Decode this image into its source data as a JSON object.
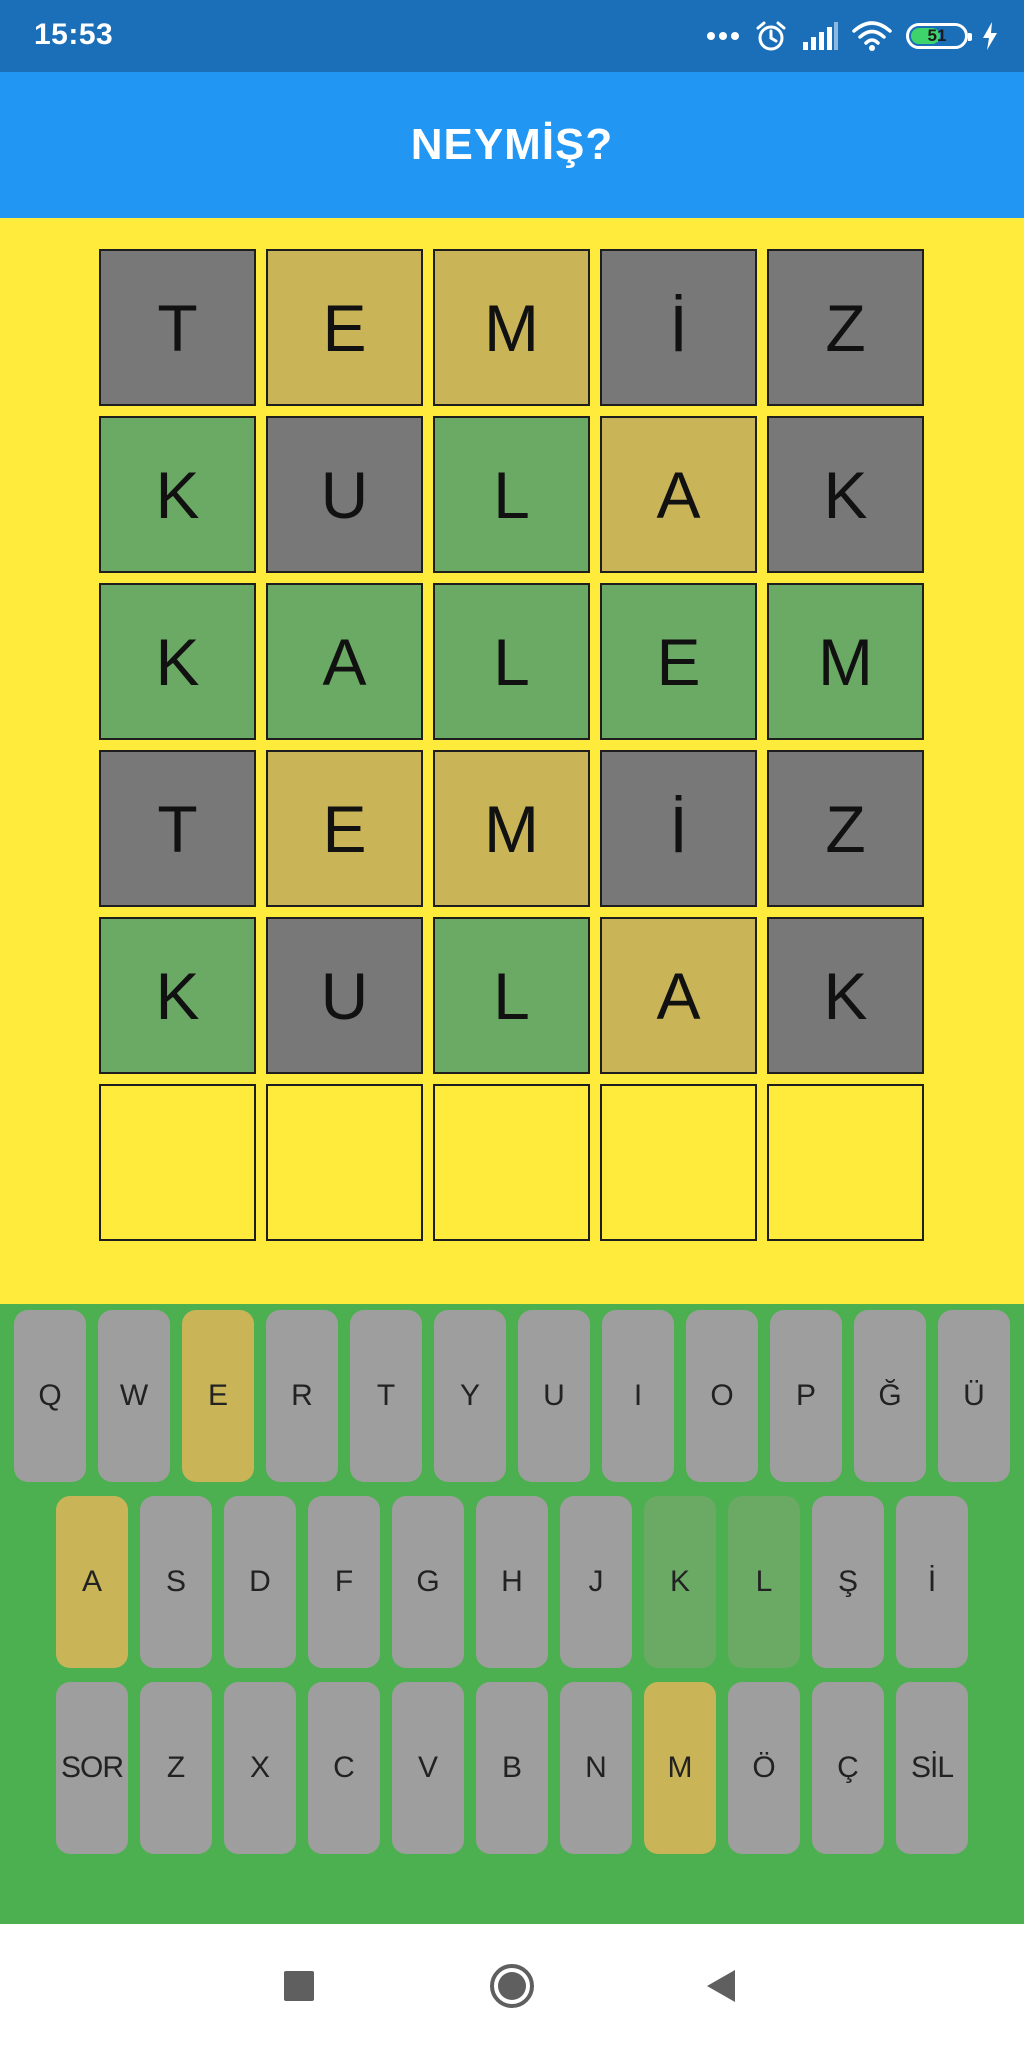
{
  "status_bar": {
    "time": "15:53",
    "battery_level": "51",
    "icons": [
      "more-dots-icon",
      "alarm-icon",
      "signal-icon",
      "wifi-icon",
      "battery-icon",
      "charging-icon"
    ]
  },
  "app_bar": {
    "title": "NEYMİŞ?"
  },
  "board": {
    "rows": [
      [
        {
          "letter": "T",
          "state": "gray"
        },
        {
          "letter": "E",
          "state": "yellow"
        },
        {
          "letter": "M",
          "state": "yellow"
        },
        {
          "letter": "İ",
          "state": "gray"
        },
        {
          "letter": "Z",
          "state": "gray"
        }
      ],
      [
        {
          "letter": "K",
          "state": "green"
        },
        {
          "letter": "U",
          "state": "gray"
        },
        {
          "letter": "L",
          "state": "green"
        },
        {
          "letter": "A",
          "state": "yellow"
        },
        {
          "letter": "K",
          "state": "gray"
        }
      ],
      [
        {
          "letter": "K",
          "state": "green"
        },
        {
          "letter": "A",
          "state": "green"
        },
        {
          "letter": "L",
          "state": "green"
        },
        {
          "letter": "E",
          "state": "green"
        },
        {
          "letter": "M",
          "state": "green"
        }
      ],
      [
        {
          "letter": "T",
          "state": "gray"
        },
        {
          "letter": "E",
          "state": "yellow"
        },
        {
          "letter": "M",
          "state": "yellow"
        },
        {
          "letter": "İ",
          "state": "gray"
        },
        {
          "letter": "Z",
          "state": "gray"
        }
      ],
      [
        {
          "letter": "K",
          "state": "green"
        },
        {
          "letter": "U",
          "state": "gray"
        },
        {
          "letter": "L",
          "state": "green"
        },
        {
          "letter": "A",
          "state": "yellow"
        },
        {
          "letter": "K",
          "state": "gray"
        }
      ],
      [
        {
          "letter": "",
          "state": "empty"
        },
        {
          "letter": "",
          "state": "empty"
        },
        {
          "letter": "",
          "state": "empty"
        },
        {
          "letter": "",
          "state": "empty"
        },
        {
          "letter": "",
          "state": "empty"
        }
      ]
    ]
  },
  "keyboard": {
    "rows": [
      [
        {
          "label": "Q",
          "state": "default"
        },
        {
          "label": "W",
          "state": "default"
        },
        {
          "label": "E",
          "state": "yellow"
        },
        {
          "label": "R",
          "state": "default"
        },
        {
          "label": "T",
          "state": "default"
        },
        {
          "label": "Y",
          "state": "default"
        },
        {
          "label": "U",
          "state": "default"
        },
        {
          "label": "I",
          "state": "default"
        },
        {
          "label": "O",
          "state": "default"
        },
        {
          "label": "P",
          "state": "default"
        },
        {
          "label": "Ğ",
          "state": "default"
        },
        {
          "label": "Ü",
          "state": "default"
        }
      ],
      [
        {
          "label": "A",
          "state": "yellow"
        },
        {
          "label": "S",
          "state": "default"
        },
        {
          "label": "D",
          "state": "default"
        },
        {
          "label": "F",
          "state": "default"
        },
        {
          "label": "G",
          "state": "default"
        },
        {
          "label": "H",
          "state": "default"
        },
        {
          "label": "J",
          "state": "default"
        },
        {
          "label": "K",
          "state": "green"
        },
        {
          "label": "L",
          "state": "green"
        },
        {
          "label": "Ş",
          "state": "default"
        },
        {
          "label": "İ",
          "state": "default"
        }
      ],
      [
        {
          "label": "SOR",
          "state": "default"
        },
        {
          "label": "Z",
          "state": "default"
        },
        {
          "label": "X",
          "state": "default"
        },
        {
          "label": "C",
          "state": "default"
        },
        {
          "label": "V",
          "state": "default"
        },
        {
          "label": "B",
          "state": "default"
        },
        {
          "label": "N",
          "state": "default"
        },
        {
          "label": "M",
          "state": "yellow"
        },
        {
          "label": "Ö",
          "state": "default"
        },
        {
          "label": "Ç",
          "state": "default"
        },
        {
          "label": "SİL",
          "state": "default"
        }
      ]
    ]
  },
  "nav_bar": {
    "icons": [
      "recent-apps-icon",
      "home-icon",
      "back-icon"
    ]
  },
  "colors": {
    "status_bar": "#1b6fb9",
    "app_bar": "#2196f3",
    "board_background": "#ffeb3b",
    "keyboard_background": "#4caf50",
    "tile_gray": "#787878",
    "tile_yellow": "#c9b458",
    "tile_green": "#6aaa64",
    "key_default": "#9e9e9e"
  }
}
